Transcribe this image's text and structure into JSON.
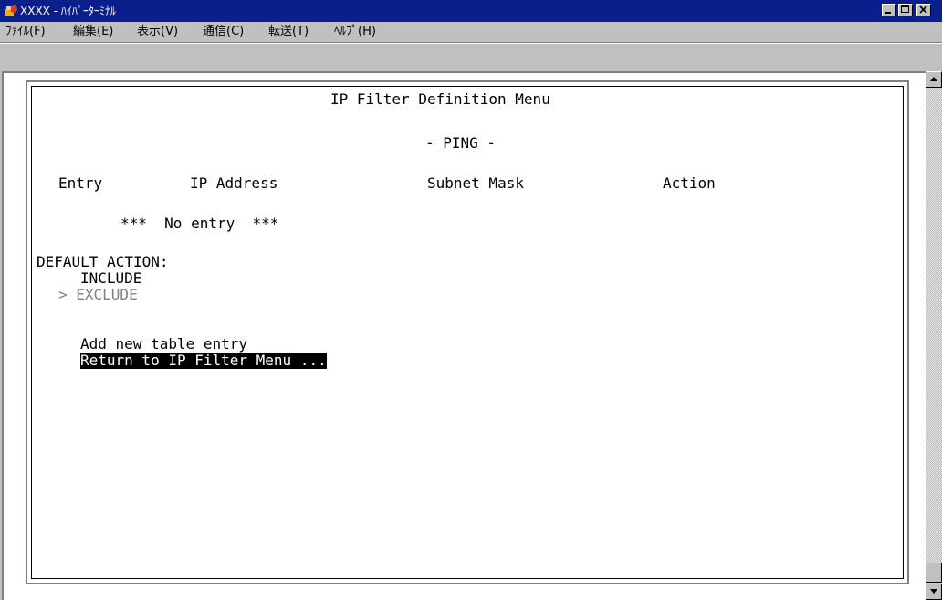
{
  "window": {
    "title": "XXXX - ﾊｲﾊﾟｰﾀｰﾐﾅﾙ",
    "icon": "hyperterminal-icon"
  },
  "menu": [
    "ﾌｧｲﾙ(F)",
    "編集(E)",
    "表示(V)",
    "通信(C)",
    "転送(T)",
    "ﾍﾙﾌﾟ(H)"
  ],
  "terminal": {
    "title": "IP Filter Definition Menu",
    "subtitle": "- PING -",
    "columns": [
      "Entry",
      "IP Address",
      "Subnet Mask",
      "Action"
    ],
    "empty_message": "***  No entry  ***",
    "default_action_label": "DEFAULT ACTION:",
    "options": {
      "include": "INCLUDE",
      "exclude": "> EXCLUDE"
    },
    "actions": {
      "add": "Add new table entry",
      "return": "Return to IP Filter Menu ..."
    }
  },
  "colors": {
    "titlebar": "#0a1e8c",
    "selection_bg": "#000000",
    "dim_text": "#808080"
  }
}
